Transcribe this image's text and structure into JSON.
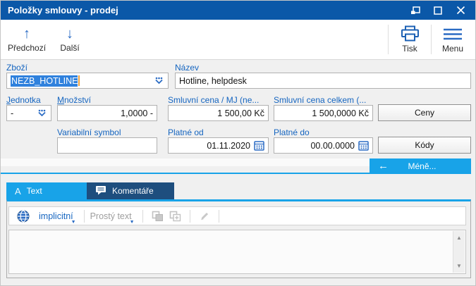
{
  "colors": {
    "titlebar": "#0b58a8",
    "accent": "#18a3e8",
    "label-blue": "#1565c0",
    "tab-navy": "#1e4e7e",
    "selection": "#2f81dd",
    "icon-blue": "#2b6cc4"
  },
  "window": {
    "title": "Položky smlouvy - prodej"
  },
  "toolbar": {
    "previous": "Předchozí",
    "next": "Další",
    "print": "Tisk",
    "menu": "Menu"
  },
  "icons": {
    "up": "↑",
    "down": "↓",
    "back": "←",
    "dropdown": "▼",
    "scroll_up": "▲",
    "scroll_down": "▼"
  },
  "form": {
    "zbozi": {
      "label": "Zboží",
      "value": "NEZB_HOTLINE"
    },
    "nazev": {
      "label": "Název",
      "value": "Hotline, helpdesk"
    },
    "jednotka": {
      "label": "Jednotka",
      "value": "-"
    },
    "mnozstvi": {
      "label": "Množství",
      "value": "1,0000 -"
    },
    "cena_mj": {
      "label": "Smluvní cena / MJ (ne...",
      "value": "1 500,00 Kč"
    },
    "cena_celkem": {
      "label": "Smluvní cena celkem (...",
      "value": "1 500,0000 Kč"
    },
    "var_symbol": {
      "label": "Variabilní symbol",
      "value": ""
    },
    "platne_od": {
      "label": "Platné od",
      "value": "01.11.2020"
    },
    "platne_do": {
      "label": "Platné do",
      "value": "00.00.0000"
    },
    "ceny_button": "Ceny",
    "kody_button": "Kódy",
    "mene_button": "Méně..."
  },
  "tabs": {
    "text_icon": "A",
    "text": "Text",
    "komentare": "Komentáře"
  },
  "editor": {
    "language": "implicitní",
    "format": "Prostý text",
    "content": ""
  }
}
